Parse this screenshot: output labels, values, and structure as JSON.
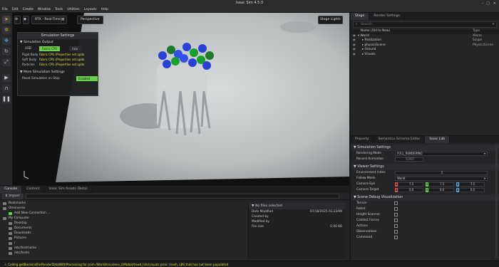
{
  "app": {
    "title": "Isaac Sim 4.5.0"
  },
  "menu": [
    "File",
    "Edit",
    "Create",
    "Window",
    "Tools",
    "Utilities",
    "Layouts",
    "Help"
  ],
  "viewport": {
    "rtx_label": "RTX - Real-Time",
    "camera_label": "Perspective",
    "lights_label": "Stage Lights"
  },
  "sim_panel": {
    "title": "Simulation Settings",
    "output_section": "Simulation Output",
    "usd_label": "USD",
    "fabric_cpu": "Fabric CPU",
    "fabric_gpu": "Fabr",
    "rows": [
      {
        "label": "Rigid Body",
        "value": "Fabric CPU (Properties not upda"
      },
      {
        "label": "Soft Body",
        "value": "Fabric CPU (Properties not upda"
      },
      {
        "label": "Particles",
        "value": "Fabric CPU (Properties not upda"
      }
    ],
    "more_section": "More Simulation Settings",
    "reset_label": "Reset Simulation on Stop",
    "reset_value": "Enabled"
  },
  "stage": {
    "tabs": [
      "Stage",
      "Render Settings"
    ],
    "search_placeholder": "Search",
    "col_name": "Name (Old to New)",
    "col_type": "Type",
    "rows": [
      {
        "name": "World",
        "type": "Xform",
        "indent": 0
      },
      {
        "name": "Realization",
        "type": "Scope",
        "indent": 1
      },
      {
        "name": "physicsScene",
        "type": "PhysicsScene",
        "indent": 1
      },
      {
        "name": "Ground",
        "type": "",
        "indent": 1
      },
      {
        "name": "Visuals",
        "type": "",
        "indent": 1
      }
    ]
  },
  "props": {
    "tabs": [
      "Property",
      "Semantics Schema Editor",
      "Isaac Lab"
    ],
    "sim_section": "Simulation Settings",
    "rendering_mode_label": "Rendering Mode",
    "rendering_mode_value": "FULL_RENDERING",
    "record_label": "Record Animation",
    "record_value": "START",
    "viewer_section": "Viewer Settings",
    "env_index_label": "Environment Index",
    "env_index_value": "1",
    "follow_label": "Follow Mode",
    "follow_value": "World",
    "cam_eye_label": "Camera Eye",
    "cam_eye": [
      "7.5",
      "7.5",
      "7.5"
    ],
    "cam_target_label": "Camera Target",
    "cam_target": [
      "0.0",
      "0.0",
      "0.0"
    ],
    "debug_section": "Scene Debug Visualization",
    "debug_items": [
      "Terrain",
      "Robot",
      "Height Scanner",
      "Contact Forces",
      "Actions",
      "Observations",
      "Command"
    ]
  },
  "bottom": {
    "tabs": [
      "Console",
      "Content",
      "Isaac Sim Assets (Beta)"
    ],
    "import_label": "Import",
    "tree": [
      {
        "label": "Bookmarks",
        "indent": 0
      },
      {
        "label": "Omniverse",
        "indent": 0
      },
      {
        "label": "Add New Connection ...",
        "indent": 1
      },
      {
        "label": "My Computer",
        "indent": 0
      },
      {
        "label": "Desktop",
        "indent": 1
      },
      {
        "label": "Documents",
        "indent": 1
      },
      {
        "label": "Downloads",
        "indent": 1
      },
      {
        "label": "Pictures",
        "indent": 1
      },
      {
        "label": "/",
        "indent": 1
      },
      {
        "label": "/etc/hostname",
        "indent": 1
      },
      {
        "label": "/etc/hosts",
        "indent": 1
      }
    ],
    "info_title": "No files selected",
    "info_rows": [
      {
        "label": "Date Modified",
        "value": "07/18/2025 01:23AM"
      },
      {
        "label": "Created by",
        "value": ""
      },
      {
        "label": "Modified by",
        "value": ""
      },
      {
        "label": "File size",
        "value": "0.00 KB"
      }
    ]
  },
  "status": {
    "text": "Calling getBackendForRenderDataWithProcessing for prim /World/envs/env_0/Robot/head_link/visuals prim: mesh, LBS that has not been populated"
  },
  "colors": {
    "accent_green": "#6bd04a",
    "warn_yellow": "#e6e23a",
    "toolbar_orange": "#d9a54a"
  }
}
